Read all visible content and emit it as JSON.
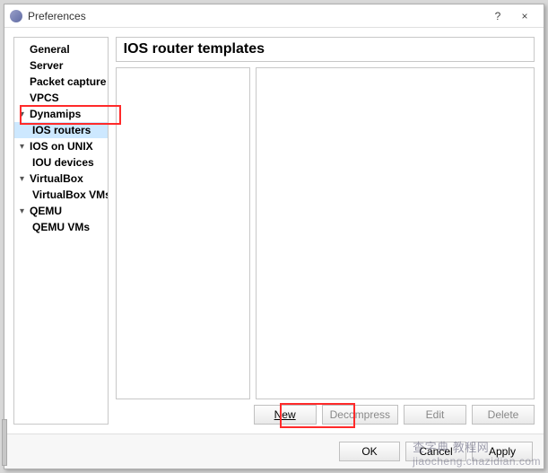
{
  "window": {
    "title": "Preferences",
    "help_label": "?",
    "close_label": "×"
  },
  "sidebar": {
    "items": [
      {
        "label": "General",
        "level": 0,
        "expandable": false,
        "selected": false
      },
      {
        "label": "Server",
        "level": 0,
        "expandable": false,
        "selected": false
      },
      {
        "label": "Packet capture",
        "level": 0,
        "expandable": false,
        "selected": false
      },
      {
        "label": "VPCS",
        "level": 0,
        "expandable": false,
        "selected": false
      },
      {
        "label": "Dynamips",
        "level": 0,
        "expandable": true,
        "selected": false
      },
      {
        "label": "IOS routers",
        "level": 1,
        "expandable": false,
        "selected": true
      },
      {
        "label": "IOS on UNIX",
        "level": 0,
        "expandable": true,
        "selected": false
      },
      {
        "label": "IOU devices",
        "level": 1,
        "expandable": false,
        "selected": false
      },
      {
        "label": "VirtualBox",
        "level": 0,
        "expandable": true,
        "selected": false
      },
      {
        "label": "VirtualBox VMs",
        "level": 1,
        "expandable": false,
        "selected": false
      },
      {
        "label": "QEMU",
        "level": 0,
        "expandable": true,
        "selected": false
      },
      {
        "label": "QEMU VMs",
        "level": 1,
        "expandable": false,
        "selected": false
      }
    ]
  },
  "main": {
    "heading": "IOS router templates",
    "buttons": {
      "new": "New",
      "decompress": "Decompress",
      "edit": "Edit",
      "delete": "Delete"
    }
  },
  "footer": {
    "ok": "OK",
    "cancel": "Cancel",
    "apply": "Apply"
  },
  "watermark": {
    "line1": "查字典 教程网",
    "line2": "jiaocheng.chazidian.com"
  }
}
